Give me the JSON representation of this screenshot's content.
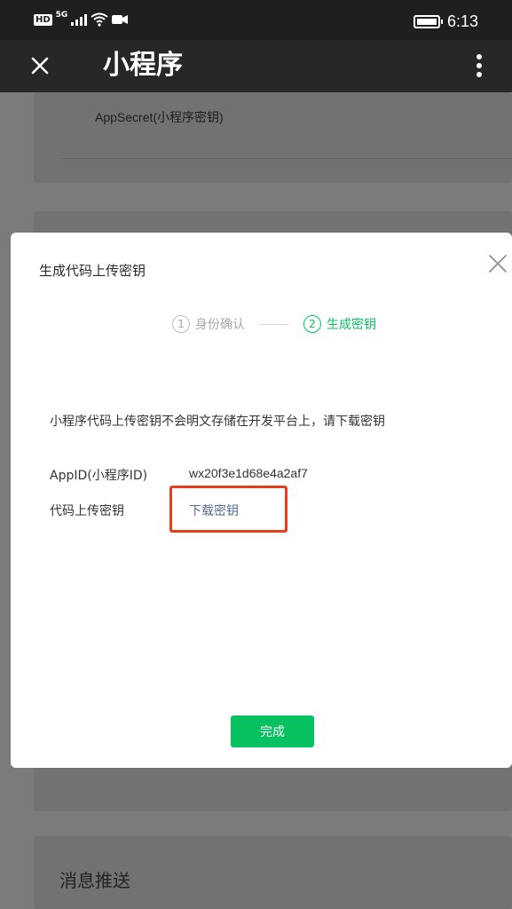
{
  "status_bar": {
    "hd": "HD",
    "network": "5G",
    "time": "6:13"
  },
  "nav": {
    "title": "小程序"
  },
  "background": {
    "appsecret_label": "AppSecret(小程序密钥)",
    "message_push_heading": "消息推送"
  },
  "dialog": {
    "title": "生成代码上传密钥",
    "steps": [
      {
        "number": "1",
        "label": "身份确认"
      },
      {
        "number": "2",
        "label": "生成密钥"
      }
    ],
    "notice": "小程序代码上传密钥不会明文存储在开发平台上，请下载密钥",
    "appid_label": "AppID(小程序ID)",
    "appid_value": "wx20f3e1d68e4a2af7",
    "key_label": "代码上传密钥",
    "download_link": "下载密钥",
    "done_button": "完成"
  },
  "colors": {
    "accent_green": "#07c160",
    "link_blue": "#576b95",
    "highlight_red": "#e53e1a"
  },
  "icons": {
    "close": "close-icon",
    "more": "more-vertical-icon",
    "signal": "signal-icon",
    "wifi": "wifi-icon",
    "video": "video-icon",
    "battery": "battery-icon"
  }
}
